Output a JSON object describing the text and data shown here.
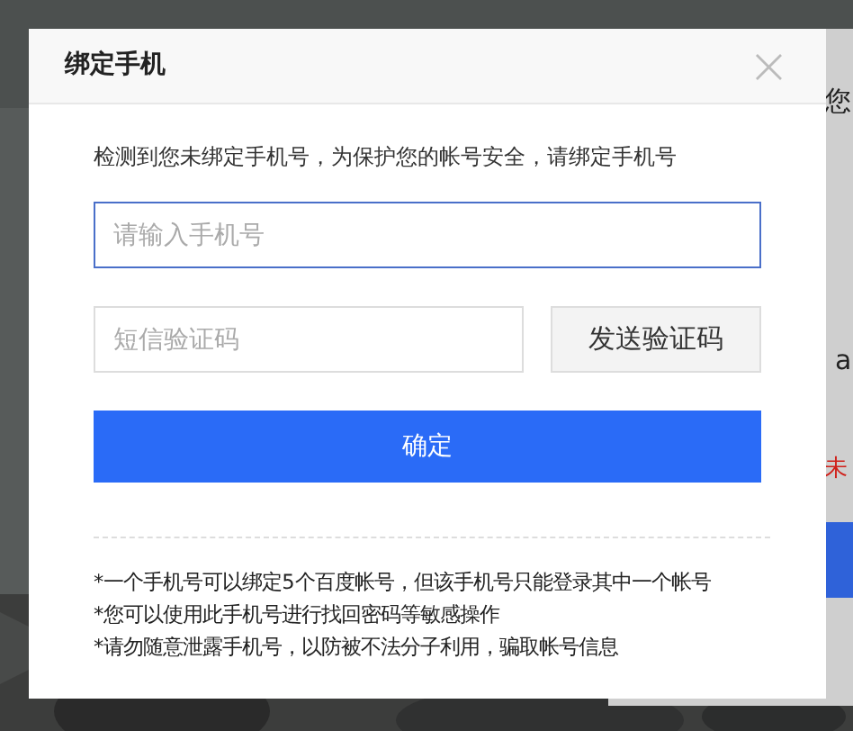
{
  "background_page": {
    "kind": "picture",
    "panel_texts": [
      {
        "text": "您",
        "kind": "plain"
      },
      {
        "text": "a",
        "kind": "plain"
      },
      {
        "text": "未",
        "kind": "warning"
      }
    ]
  },
  "dialog": {
    "title": "绑定手机",
    "close": "×",
    "notice": "检测到您未绑定手机号，为保护您的帐号安全，请绑定手机号",
    "phone_field": {
      "placeholder": "请输入手机号",
      "focused": true
    },
    "code_field": {
      "placeholder": "短信验证码"
    },
    "send_button": "发送验证码",
    "confirm_button": "确定",
    "notes": [
      "*一个手机号可以绑定5个百度帐号，但该手机号只能登录其中一个帐号",
      "*您可以使用此手机号进行找回密码等敏感操作",
      "*请勿随意泄露手机号，以防被不法分子利用，骗取帐号信息"
    ]
  }
}
